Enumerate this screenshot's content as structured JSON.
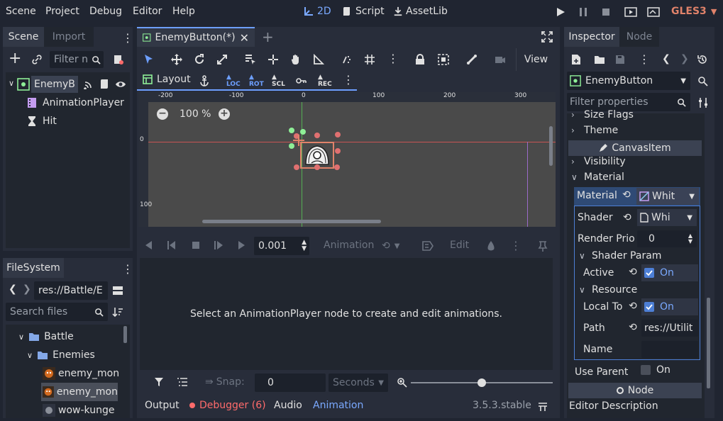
{
  "menubar": {
    "items": [
      "Scene",
      "Project",
      "Debug",
      "Editor",
      "Help"
    ],
    "mode_2d": "2D",
    "mode_script": "Script",
    "mode_assetlib": "AssetLib",
    "renderer": "GLES3"
  },
  "scene_dock": {
    "tab_scene": "Scene",
    "tab_import": "Import",
    "filter_placeholder": "Filter n",
    "nodes": [
      {
        "label": "EnemyB",
        "icon": "control-node-icon"
      },
      {
        "label": "AnimationPlayer",
        "icon": "film-icon"
      },
      {
        "label": "Hit",
        "icon": "hourglass-icon"
      }
    ]
  },
  "filesystem": {
    "tab": "FileSystem",
    "path": "res://Battle/E",
    "search_placeholder": "Search files",
    "items": [
      {
        "label": "Battle",
        "type": "folder"
      },
      {
        "label": "Enemies",
        "type": "folder"
      },
      {
        "label": "enemy_mon",
        "type": "image"
      },
      {
        "label": "enemy_mon",
        "type": "image"
      },
      {
        "label": "wow-kunge",
        "type": "image"
      }
    ]
  },
  "editor": {
    "tab_title": "EnemyButton(*)",
    "view_label": "View",
    "layout_label": "Layout",
    "zoom": "100 %",
    "ruler_ticks": [
      "-200",
      "-100",
      "0",
      "100",
      "200",
      "300"
    ],
    "ruler_vticks": [
      "0",
      "100"
    ]
  },
  "animation": {
    "time_value": "0.001",
    "animation_label": "Animation",
    "edit_label": "Edit",
    "message": "Select an AnimationPlayer node to create and edit animations.",
    "snap_label": "Snap:",
    "snap_value": "0",
    "seconds_label": "Seconds",
    "slider_level": 0.5
  },
  "bottom_bar": {
    "output": "Output",
    "debugger": "Debugger (6)",
    "audio": "Audio",
    "animation": "Animation",
    "version": "3.5.3.stable"
  },
  "inspector": {
    "tab_inspector": "Inspector",
    "tab_node": "Node",
    "object_name": "EnemyButton",
    "filter_placeholder": "Filter properties",
    "size_flags": "Size Flags",
    "theme": "Theme",
    "canvas_item": "CanvasItem",
    "visibility": "Visibility",
    "material_section": "Material",
    "material_label": "Material",
    "material_value": "Whit",
    "shader_label": "Shader",
    "shader_value": "Whi",
    "render_prio_label": "Render Prio",
    "render_prio_value": "0",
    "shader_param": "Shader Param",
    "active_label": "Active",
    "active_value": "On",
    "resource_section": "Resource",
    "local_to_label": "Local To",
    "local_to_value": "On",
    "path_label": "Path",
    "path_value": "res://Utilit",
    "name_label": "Name",
    "use_parent_label": "Use Parent",
    "use_parent_value": "On",
    "node_section": "Node",
    "editor_description": "Editor Description"
  },
  "colors": {
    "accent": "#6d9fff",
    "background": "#202531",
    "panel": "#282d3a",
    "viewport": "#4a4a4a",
    "error": "#ff6b6b",
    "selection": "#e0826a"
  }
}
